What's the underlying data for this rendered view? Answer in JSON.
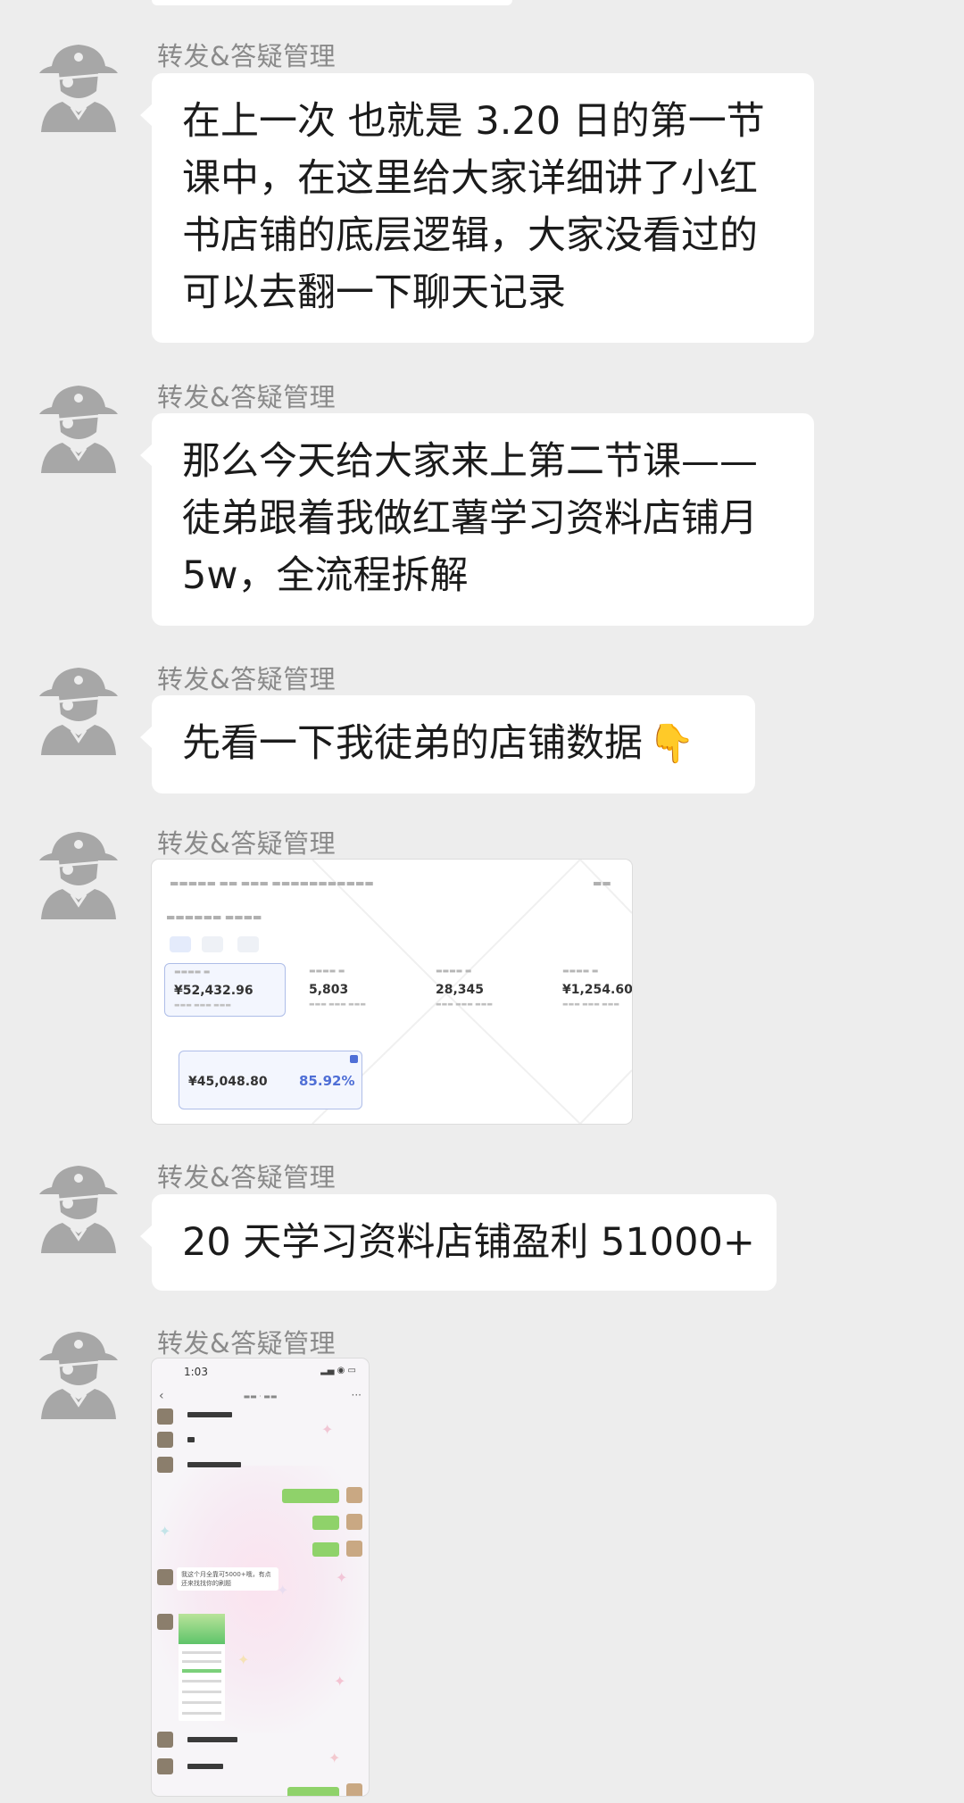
{
  "messages": [
    {
      "sender": "转发&答疑管理",
      "lines": [
        "在上一次 也就是 3.20 日的第一节",
        "课中，在这里给大家详细讲了小红",
        "书店铺的底层逻辑，大家没看过的",
        "可以去翻一下聊天记录"
      ]
    },
    {
      "sender": "转发&答疑管理",
      "lines": [
        "那么今天给大家来上第二节课——",
        "徒弟跟着我做红薯学习资料店铺月",
        "5w，全流程拆解"
      ]
    },
    {
      "sender": "转发&答疑管理",
      "lines": [
        "先看一下我徒弟的店铺数据"
      ],
      "emoji": "👇"
    },
    {
      "sender": "转发&答疑管理",
      "image": {
        "metrics": [
          "¥52,432.96",
          "5,803",
          "28,345",
          "¥1,254.60"
        ],
        "metric2_value": "¥45,048.80",
        "metric2_pct": "85.92%"
      }
    },
    {
      "sender": "转发&答疑管理",
      "lines": [
        "20 天学习资料店铺盈利 51000+"
      ]
    },
    {
      "sender": "转发&答疑管理",
      "image": {
        "status_time": "1:03",
        "chat_text": "我这个月全靠可5000+哦，有点还来找找你的刷题"
      }
    }
  ],
  "icons": {
    "avatar": "pirate-avatar-icon",
    "emoji": "pointing-down-hand"
  },
  "colors": {
    "background": "#ededed",
    "bubble": "#ffffff",
    "sender_text": "#8a8a8a",
    "accent_blue": "#4f6fd6",
    "wechat_green": "#8fd26a"
  }
}
